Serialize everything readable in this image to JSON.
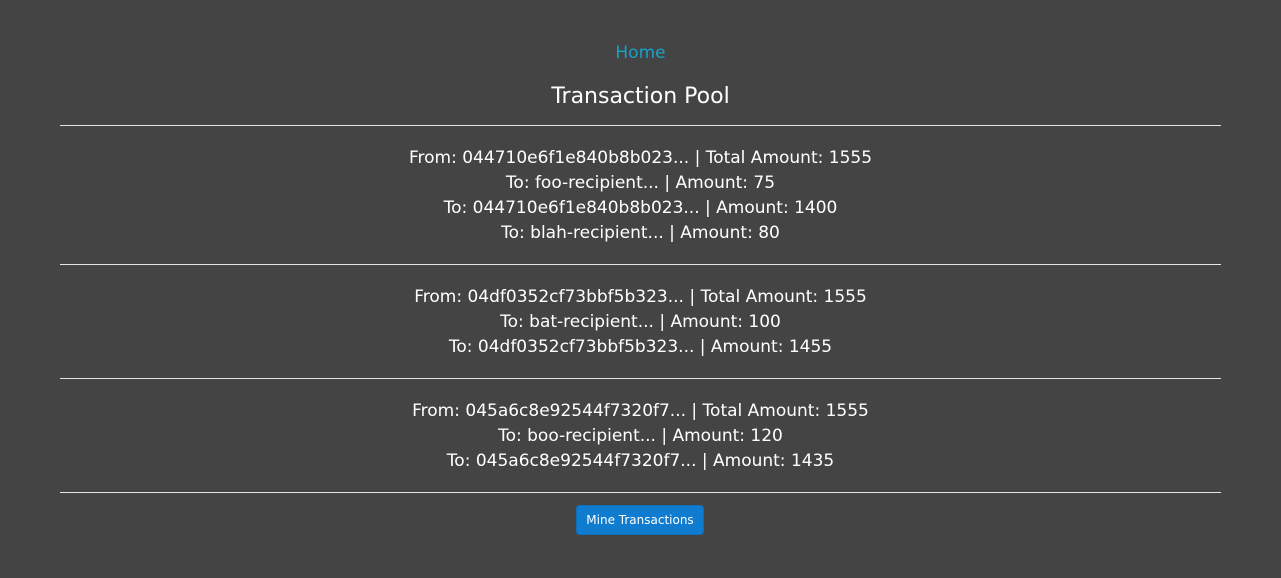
{
  "nav": {
    "home_label": "Home"
  },
  "page": {
    "title": "Transaction Pool"
  },
  "transactions": [
    {
      "from_line": "From: 044710e6f1e840b8b023... | Total Amount: 1555",
      "outputs": [
        "To: foo-recipient... | Amount: 75",
        "To: 044710e6f1e840b8b023... | Amount: 1400",
        "To: blah-recipient... | Amount: 80"
      ]
    },
    {
      "from_line": "From: 04df0352cf73bbf5b323... | Total Amount: 1555",
      "outputs": [
        "To: bat-recipient... | Amount: 100",
        "To: 04df0352cf73bbf5b323... | Amount: 1455"
      ]
    },
    {
      "from_line": "From: 045a6c8e92544f7320f7... | Total Amount: 1555",
      "outputs": [
        "To: boo-recipient... | Amount: 120",
        "To: 045a6c8e92544f7320f7... | Amount: 1435"
      ]
    }
  ],
  "actions": {
    "mine_label": "Mine Transactions"
  },
  "colors": {
    "background": "#444444",
    "link": "#17a2c8",
    "button": "#0f7ccf",
    "text": "#ffffff"
  }
}
